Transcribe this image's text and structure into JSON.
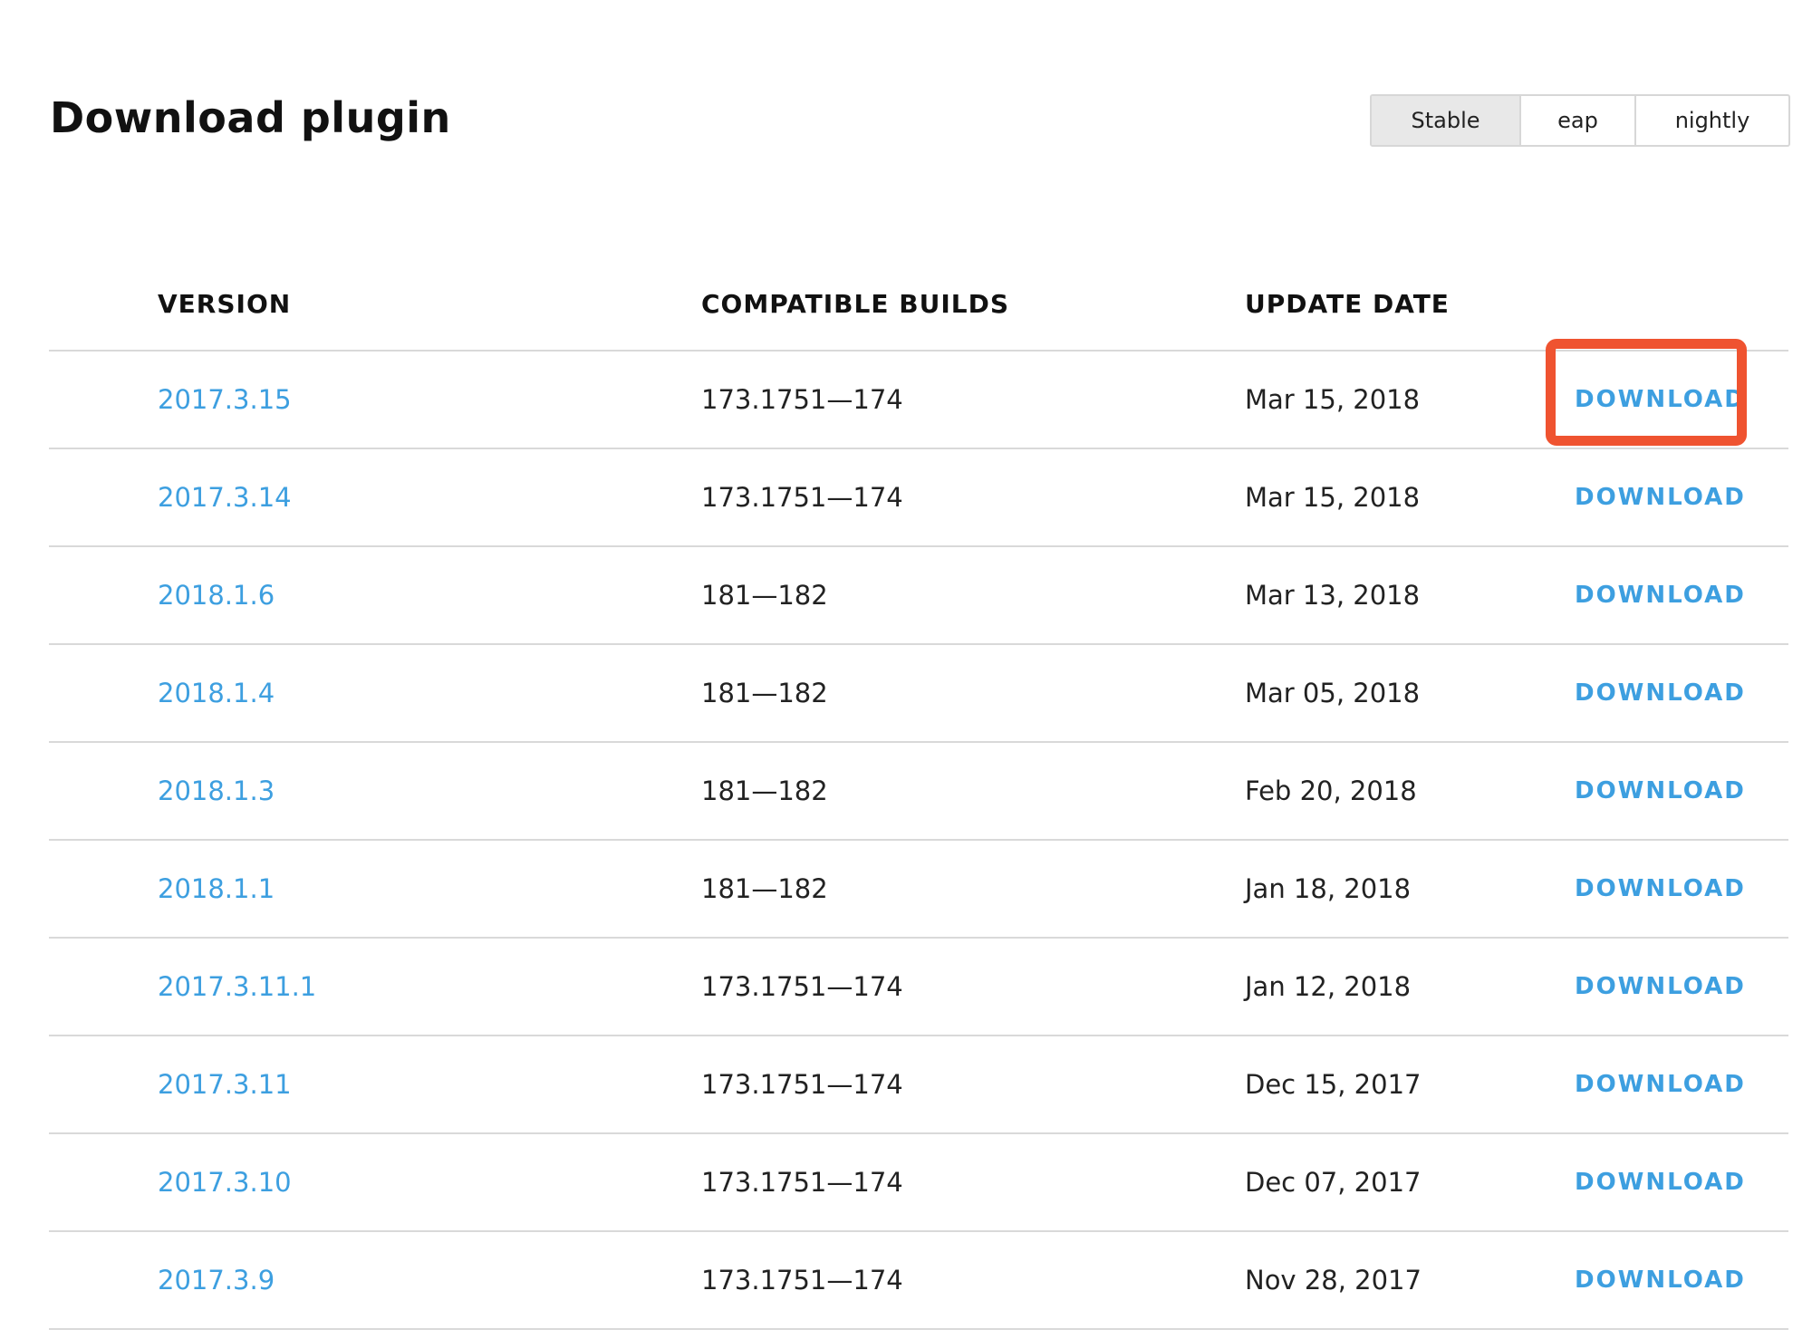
{
  "page": {
    "title": "Download plugin"
  },
  "channels": {
    "stable": "Stable",
    "eap": "eap",
    "nightly": "nightly",
    "selected": "Stable"
  },
  "table": {
    "headers": {
      "version": "VERSION",
      "builds": "COMPATIBLE BUILDS",
      "date": "UPDATE DATE"
    },
    "download_label": "DOWNLOAD",
    "rows": [
      {
        "version": "2017.3.15",
        "builds": "173.1751—174",
        "date": "Mar 15, 2018",
        "action": "DOWNLOAD"
      },
      {
        "version": "2017.3.14",
        "builds": "173.1751—174",
        "date": "Mar 15, 2018",
        "action": "DOWNLOAD"
      },
      {
        "version": "2018.1.6",
        "builds": "181—182",
        "date": "Mar 13, 2018",
        "action": "DOWNLOAD"
      },
      {
        "version": "2018.1.4",
        "builds": "181—182",
        "date": "Mar 05, 2018",
        "action": "DOWNLOAD"
      },
      {
        "version": "2018.1.3",
        "builds": "181—182",
        "date": "Feb 20, 2018",
        "action": "DOWNLOAD"
      },
      {
        "version": "2018.1.1",
        "builds": "181—182",
        "date": "Jan 18, 2018",
        "action": "DOWNLOAD"
      },
      {
        "version": "2017.3.11.1",
        "builds": "173.1751—174",
        "date": "Jan 12, 2018",
        "action": "DOWNLOAD"
      },
      {
        "version": "2017.3.11",
        "builds": "173.1751—174",
        "date": "Dec 15, 2017",
        "action": "DOWNLOAD"
      },
      {
        "version": "2017.3.10",
        "builds": "173.1751—174",
        "date": "Dec 07, 2017",
        "action": "DOWNLOAD"
      },
      {
        "version": "2017.3.9",
        "builds": "173.1751—174",
        "date": "Nov 28, 2017",
        "action": "DOWNLOAD"
      }
    ]
  },
  "annotation": {
    "highlight_color": "#ef5330"
  },
  "colors": {
    "link": "#3d9fe0",
    "divider": "#d9d9d9",
    "active_toggle_bg": "#e8e8e8"
  }
}
